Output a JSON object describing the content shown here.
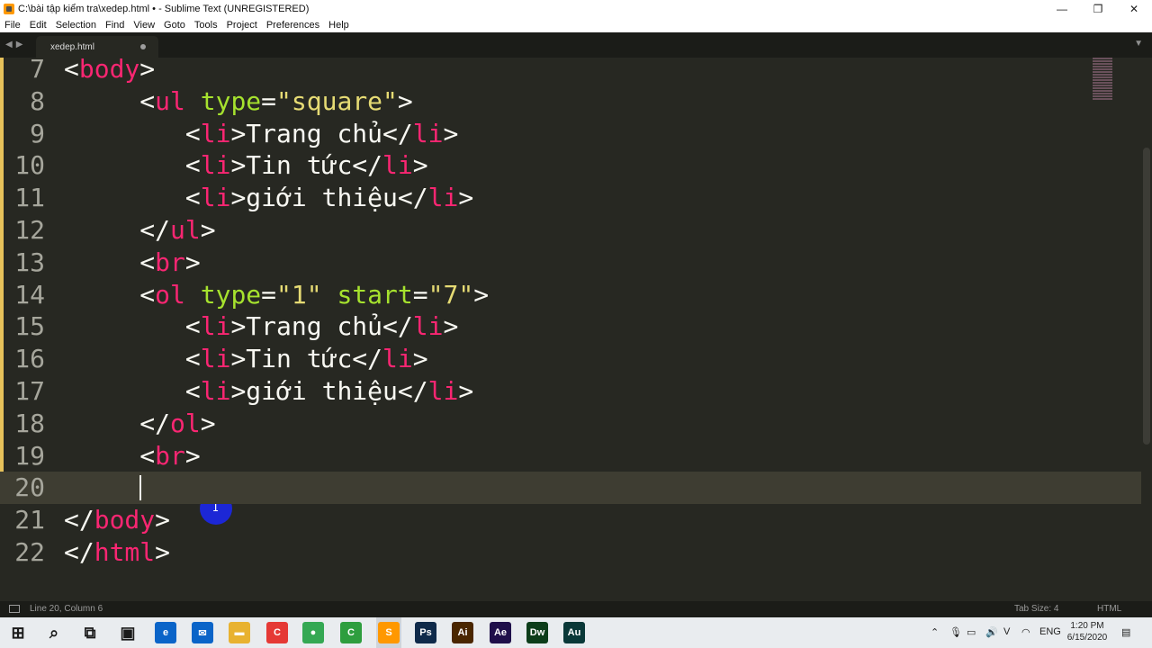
{
  "window": {
    "title": "C:\\bài tập kiểm tra\\xedep.html • - Sublime Text (UNREGISTERED)",
    "controls": [
      "—",
      "❐",
      "✕"
    ]
  },
  "menu": [
    "File",
    "Edit",
    "Selection",
    "Find",
    "View",
    "Goto",
    "Tools",
    "Project",
    "Preferences",
    "Help"
  ],
  "tabs": [
    {
      "label": "xedep.html",
      "dirty": true
    }
  ],
  "editor": {
    "lines": [
      {
        "no": "7",
        "indent": "",
        "tokens": [
          [
            "pn",
            "<"
          ],
          [
            "tg",
            "body"
          ],
          [
            "pn",
            ">"
          ]
        ]
      },
      {
        "no": "8",
        "indent": "     ",
        "tokens": [
          [
            "pn",
            "<"
          ],
          [
            "tg",
            "ul"
          ],
          [
            "pn",
            " "
          ],
          [
            "at",
            "type"
          ],
          [
            "pn",
            "="
          ],
          [
            "st",
            "\"square\""
          ],
          [
            "pn",
            ">"
          ]
        ]
      },
      {
        "no": "9",
        "indent": "        ",
        "tokens": [
          [
            "pn",
            "<"
          ],
          [
            "tg",
            "li"
          ],
          [
            "pn",
            ">Trang chủ</"
          ],
          [
            "tg",
            "li"
          ],
          [
            "pn",
            ">"
          ]
        ]
      },
      {
        "no": "10",
        "indent": "        ",
        "tokens": [
          [
            "pn",
            "<"
          ],
          [
            "tg",
            "li"
          ],
          [
            "pn",
            ">Tin tức</"
          ],
          [
            "tg",
            "li"
          ],
          [
            "pn",
            ">"
          ]
        ]
      },
      {
        "no": "11",
        "indent": "        ",
        "tokens": [
          [
            "pn",
            "<"
          ],
          [
            "tg",
            "li"
          ],
          [
            "pn",
            ">giới thiệu</"
          ],
          [
            "tg",
            "li"
          ],
          [
            "pn",
            ">"
          ]
        ]
      },
      {
        "no": "12",
        "indent": "     ",
        "tokens": [
          [
            "pn",
            "</"
          ],
          [
            "tg",
            "ul"
          ],
          [
            "pn",
            ">"
          ]
        ]
      },
      {
        "no": "13",
        "indent": "     ",
        "tokens": [
          [
            "pn",
            "<"
          ],
          [
            "tg",
            "br"
          ],
          [
            "pn",
            ">"
          ]
        ]
      },
      {
        "no": "14",
        "indent": "     ",
        "tokens": [
          [
            "pn",
            "<"
          ],
          [
            "tg",
            "ol"
          ],
          [
            "pn",
            " "
          ],
          [
            "at",
            "type"
          ],
          [
            "pn",
            "="
          ],
          [
            "st",
            "\"1\""
          ],
          [
            "pn",
            " "
          ],
          [
            "at",
            "start"
          ],
          [
            "pn",
            "="
          ],
          [
            "st",
            "\"7\""
          ],
          [
            "pn",
            ">"
          ]
        ]
      },
      {
        "no": "15",
        "indent": "        ",
        "tokens": [
          [
            "pn",
            "<"
          ],
          [
            "tg",
            "li"
          ],
          [
            "pn",
            ">Trang chủ</"
          ],
          [
            "tg",
            "li"
          ],
          [
            "pn",
            ">"
          ]
        ]
      },
      {
        "no": "16",
        "indent": "        ",
        "tokens": [
          [
            "pn",
            "<"
          ],
          [
            "tg",
            "li"
          ],
          [
            "pn",
            ">Tin tức</"
          ],
          [
            "tg",
            "li"
          ],
          [
            "pn",
            ">"
          ]
        ]
      },
      {
        "no": "17",
        "indent": "        ",
        "tokens": [
          [
            "pn",
            "<"
          ],
          [
            "tg",
            "li"
          ],
          [
            "pn",
            ">giới thiệu</"
          ],
          [
            "tg",
            "li"
          ],
          [
            "pn",
            ">"
          ]
        ]
      },
      {
        "no": "18",
        "indent": "     ",
        "tokens": [
          [
            "pn",
            "</"
          ],
          [
            "tg",
            "ol"
          ],
          [
            "pn",
            ">"
          ]
        ]
      },
      {
        "no": "19",
        "indent": "     ",
        "tokens": [
          [
            "pn",
            "<"
          ],
          [
            "tg",
            "br"
          ],
          [
            "pn",
            ">"
          ]
        ]
      },
      {
        "no": "20",
        "indent": "",
        "tokens": [],
        "current": true
      },
      {
        "no": "21",
        "indent": "",
        "tokens": [
          [
            "pn",
            "</"
          ],
          [
            "tg",
            "body"
          ],
          [
            "pn",
            ">"
          ]
        ]
      },
      {
        "no": "22",
        "indent": "",
        "tokens": [
          [
            "pn",
            "</"
          ],
          [
            "tg",
            "html"
          ],
          [
            "pn",
            ">"
          ]
        ]
      }
    ],
    "modified_lines": [
      "7",
      "8",
      "9",
      "10",
      "11",
      "12",
      "13",
      "14",
      "15",
      "16",
      "17",
      "18",
      "19"
    ]
  },
  "status": {
    "position": "Line 20, Column 6",
    "tab_size": "Tab Size: 4",
    "syntax": "HTML"
  },
  "taskbar": {
    "apps": [
      {
        "name": "windows-start-icon",
        "glyph": "⊞",
        "color": "#1a1a1a"
      },
      {
        "name": "search-icon",
        "glyph": "⌕",
        "color": "#1a1a1a"
      },
      {
        "name": "task-view-icon",
        "glyph": "⧉",
        "color": "#1a1a1a"
      },
      {
        "name": "store-icon",
        "glyph": "▣",
        "color": "#1a1a1a"
      },
      {
        "name": "edge-icon",
        "glyph": "e",
        "color": "#0a64c8"
      },
      {
        "name": "mail-icon",
        "glyph": "✉",
        "color": "#0a64c8"
      },
      {
        "name": "explorer-icon",
        "glyph": "▬",
        "color": "#e8b230"
      },
      {
        "name": "ccleaner-icon",
        "glyph": "C",
        "color": "#e53935"
      },
      {
        "name": "chrome-icon",
        "glyph": "●",
        "color": "#34a853"
      },
      {
        "name": "camtasia-icon",
        "glyph": "C",
        "color": "#2e9e3e"
      },
      {
        "name": "sublime-icon",
        "glyph": "S",
        "color": "#ff9800"
      },
      {
        "name": "photoshop-icon",
        "glyph": "Ps",
        "color": "#0f2a4a"
      },
      {
        "name": "illustrator-icon",
        "glyph": "Ai",
        "color": "#4a2600"
      },
      {
        "name": "aftereffects-icon",
        "glyph": "Ae",
        "color": "#1f0f4a"
      },
      {
        "name": "dreamweaver-icon",
        "glyph": "Dw",
        "color": "#0d3d1a"
      },
      {
        "name": "audition-icon",
        "glyph": "Au",
        "color": "#0a3838"
      }
    ],
    "tray": {
      "language": "ENG",
      "time": "1:20 PM",
      "date": "6/15/2020"
    }
  }
}
